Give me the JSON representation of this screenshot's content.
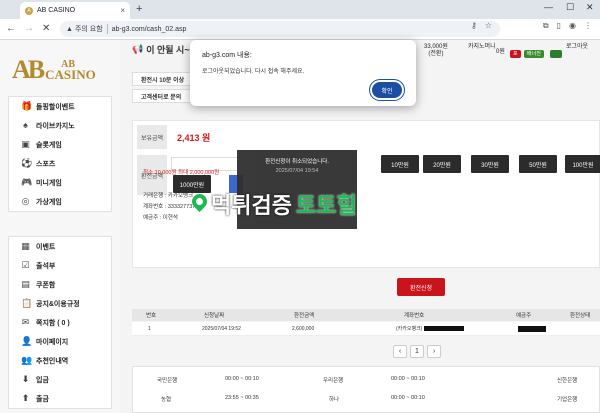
{
  "browser": {
    "tab_title": "AB CASINO",
    "tab_icon": "favicon-ab",
    "warning_label": "주의 요함",
    "url": "ab-g3.com/cash_02.asp"
  },
  "dialog": {
    "title": "ab-g3.com 내용:",
    "message": "로그아웃되었습니다. 다시 접속 해주세요.",
    "ok_label": "확인"
  },
  "site": {
    "logo_ab": "AB",
    "logo_casino_top": "AB",
    "logo_casino": "CASINO",
    "topbar_text": "이 안될 시~",
    "notices": [
      "환전시 10분 이상",
      "고객센터로 문의"
    ],
    "user_amount": "33,000원",
    "user_amount_sub": "(전환)",
    "user_kakao": "카지노머니",
    "user_zero": "0원",
    "badge1": "포",
    "badge2": "배너전",
    "logout": "로그아웃",
    "logout2": "웃"
  },
  "sidebar": {
    "group1": [
      {
        "label": "돌핑할이벤트",
        "icon": "gift-icon"
      },
      {
        "label": "라이브카지노",
        "icon": "spade-icon"
      },
      {
        "label": "슬롯게임",
        "icon": "slot-icon"
      },
      {
        "label": "스포츠",
        "icon": "ball-icon"
      },
      {
        "label": "미니게임",
        "icon": "gamepad-icon"
      },
      {
        "label": "가상게임",
        "icon": "vr-icon"
      }
    ],
    "group2": [
      {
        "label": "이벤트",
        "icon": "calendar-icon"
      },
      {
        "label": "출석부",
        "icon": "check-icon"
      },
      {
        "label": "쿠폰함",
        "icon": "coupon-icon"
      },
      {
        "label": "공지&이용규정",
        "icon": "notice-icon"
      },
      {
        "label": "쪽지함 ( 0 )",
        "icon": "mail-icon"
      },
      {
        "label": "마이페이지",
        "icon": "user-icon"
      },
      {
        "label": "추천인내역",
        "icon": "people-icon"
      },
      {
        "label": "입금",
        "icon": "deposit-icon"
      },
      {
        "label": "출금",
        "icon": "withdraw-icon"
      }
    ]
  },
  "cash": {
    "balance_label": "보유금액",
    "balance": "2,413 원",
    "amount_label": "환전금액",
    "buttons": [
      "10만원",
      "20만원",
      "30만원",
      "50만원",
      "100만원"
    ],
    "btn_1000": "1000만원",
    "minmax": "최소 10,000원 최대 2,000,000원",
    "info_lines": [
      "거래은행 : 카카오뱅크",
      "계좌번호 : 333327737****",
      "예금주 : 이현석"
    ],
    "apply_label": "환전신청"
  },
  "toast": {
    "line1": "환전신청이 취소되었습니다.",
    "line2": "2025/07/04 19:54"
  },
  "watermark": {
    "part1": "먹튀검증",
    "part2": "토토힐"
  },
  "table": {
    "headers": [
      "번호",
      "신청날짜",
      "환전금액",
      "계좌번호",
      "예금주",
      "환전상태"
    ],
    "row": [
      "1",
      "2025/07/04 19:52",
      "2,600,000",
      "(카카오뱅크)",
      "",
      ""
    ]
  },
  "pager": {
    "prev": "‹",
    "page": "1",
    "next": "›"
  },
  "banks": [
    {
      "name": "국민은행",
      "time": "00:00 ~ 00:10"
    },
    {
      "name": "우리은행",
      "time": "00:00 ~ 00:10"
    },
    {
      "name": "신한은행",
      "time": ""
    },
    {
      "name": "농협",
      "time": "23:55 ~ 00:35"
    },
    {
      "name": "하나",
      "time": "00:00 ~ 00:10"
    },
    {
      "name": "기업은행",
      "time": ""
    }
  ],
  "colors": {
    "accent_red": "#c9141c",
    "gold": "#b38a2e",
    "ok_blue": "#1b4fa6",
    "watermark_green": "#1db954"
  }
}
